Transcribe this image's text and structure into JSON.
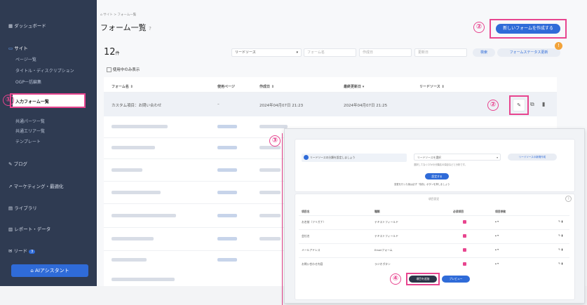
{
  "sidebar": {
    "dashboard": "ダッシュボード",
    "site": "サイト",
    "site_items": [
      "ページ一覧",
      "タイトル・ディスクリプション",
      "OGP一括編集",
      "入力フォーム一覧",
      "共通パーツ一覧",
      "共通エリア一覧",
      "テンプレート"
    ],
    "blog": "ブログ",
    "marketing": "マーケティング・最適化",
    "library": "ライブラリ",
    "report": "レポート・データ",
    "lead": "リード",
    "lead_badge": "3",
    "ai_button": "AIアシスタント"
  },
  "header": {
    "breadcrumb": "サイト > フォーム一覧",
    "title": "フォーム一覧",
    "create_button": "新しいフォームを作成する"
  },
  "filters": {
    "count_number": "12",
    "count_unit": "件",
    "lead_source": "リードソース",
    "form_name_placeholder": "フォーム名",
    "created_placeholder": "作成日",
    "updated_placeholder": "更新日",
    "search_button": "検索",
    "status_button": "フォームステータス更新",
    "only_in_use": "使用中のみ表示"
  },
  "table": {
    "headers": [
      "フォーム名 ⇕",
      "使用ページ",
      "作成日 ⇕",
      "最終更新日 ▾",
      "リードソース ⇕"
    ],
    "first_row": {
      "name": "カスタム項目：お問い合わせ",
      "page": "–",
      "created": "2024年04月07日 21:23",
      "updated": "2024年04月07日 21:25"
    }
  },
  "annotations": {
    "n1": "①",
    "n2": "②",
    "n3": "③",
    "n4": "④"
  },
  "overlay": {
    "lead_prompt": "リードソースの分類を設定しましょう",
    "lead_select": "リードソースを選択",
    "lead_create": "リードソースの新規作成",
    "lead_hint": "選択してなくCOVの分類名の項目などと分析です。",
    "set_button": "設定する",
    "set_hint": "変更を行った後は必ず「保存」ボタンを押しましょう",
    "section_label": "項目設定",
    "col_headers": [
      "項目名",
      "種類",
      "必須項目",
      "項目移動"
    ],
    "rows": [
      {
        "name": "お名前（フリガナ）",
        "type": "テキストフィールド"
      },
      {
        "name": "会社名",
        "type": "テキストフィールド"
      },
      {
        "name": "メールアドレス",
        "type": "Emailフォーム"
      },
      {
        "name": "お問い合わせ内容",
        "type": "ラジオボタン"
      }
    ],
    "add_button": "項目を追加",
    "preview_button": "プレビュー"
  }
}
